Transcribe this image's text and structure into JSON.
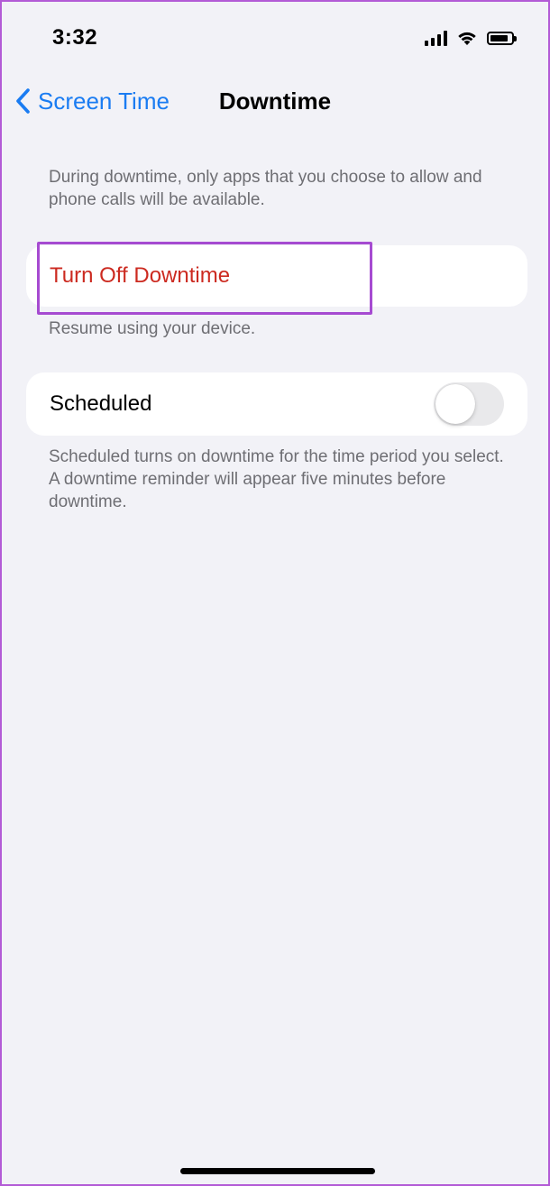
{
  "status_bar": {
    "time": "3:32",
    "icons": [
      "cellular-signal-icon",
      "wifi-icon",
      "battery-icon"
    ]
  },
  "nav": {
    "back_label": "Screen Time",
    "title": "Downtime"
  },
  "intro_text": "During downtime, only apps that you choose to allow and phone calls will be available.",
  "turn_off": {
    "label": "Turn Off Downtime",
    "footnote": "Resume using your device."
  },
  "scheduled": {
    "label": "Scheduled",
    "enabled": false,
    "footnote": "Scheduled turns on downtime for the time period you select. A downtime reminder will appear five minutes before downtime."
  },
  "colors": {
    "accent": "#1a7cf2",
    "destructive": "#cc2a20",
    "highlight": "#a64bd1",
    "background": "#f2f2f7"
  }
}
